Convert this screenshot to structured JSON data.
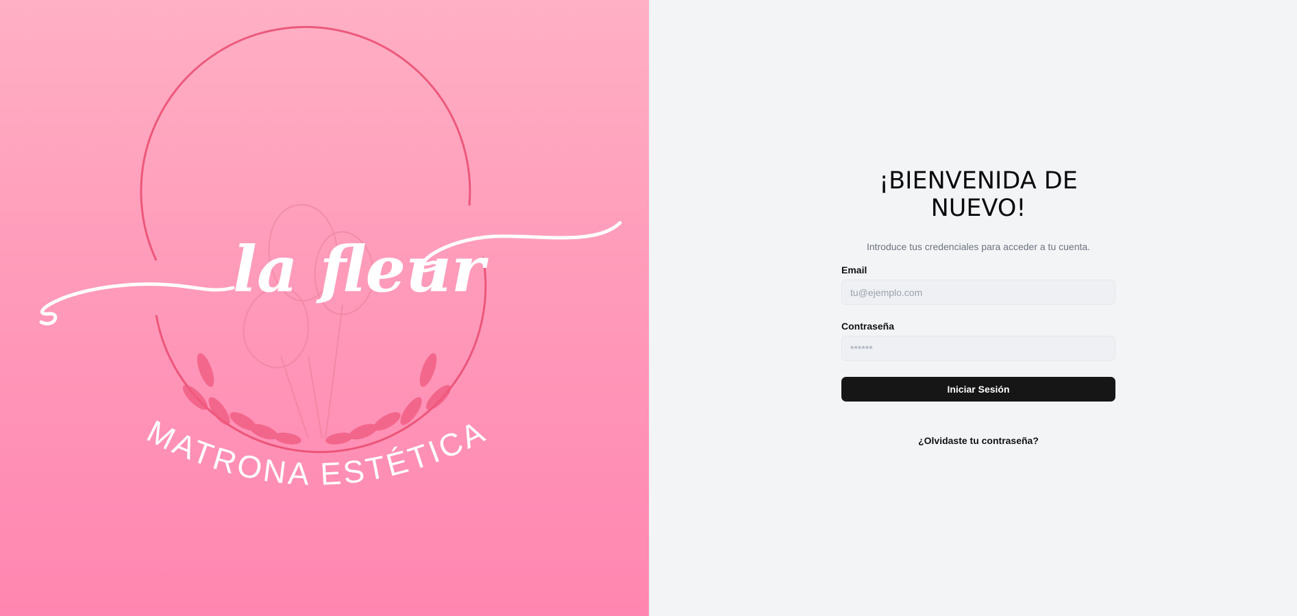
{
  "brand": {
    "script_name": "la fleur",
    "tagline": "MATRONA ESTÉTICA"
  },
  "login": {
    "title": "¡BIENVENIDA DE NUEVO!",
    "subtitle": "Introduce tus credenciales para acceder a tu cuenta.",
    "email_label": "Email",
    "email_placeholder": "tu@ejemplo.com",
    "email_value": "",
    "password_label": "Contraseña",
    "password_placeholder": "******",
    "password_value": "",
    "submit_label": "Iniciar Sesión",
    "forgot_label": "¿Olvidaste tu contraseña?"
  },
  "colors": {
    "brand_pink": "#ff9fbc",
    "button_dark": "#161616",
    "panel_bg": "#f3f4f6"
  }
}
